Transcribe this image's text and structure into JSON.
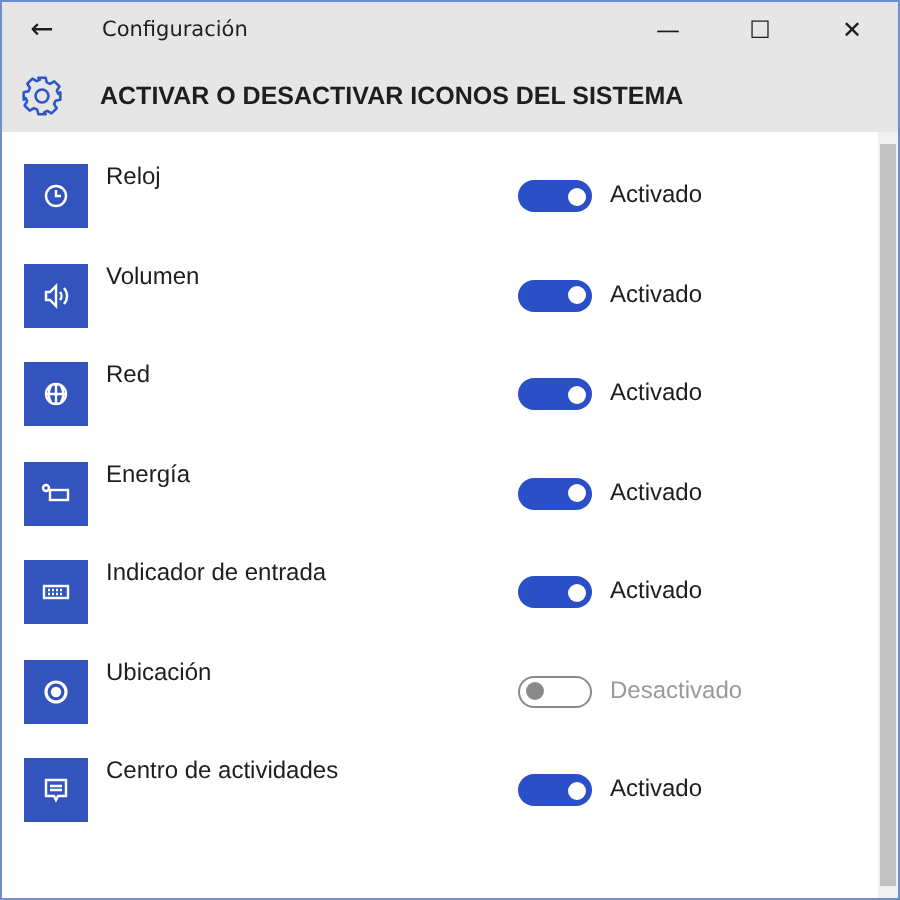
{
  "window": {
    "title": "Configuración",
    "back": "←",
    "minimize": "—",
    "maximize": "☐",
    "close": "✕"
  },
  "header": {
    "title": "ACTIVAR O DESACTIVAR ICONOS DEL SISTEMA"
  },
  "items": [
    {
      "name": "Reloj",
      "on": true,
      "state": "Activado"
    },
    {
      "name": "Volumen",
      "on": true,
      "state": "Activado"
    },
    {
      "name": "Red",
      "on": true,
      "state": "Activado"
    },
    {
      "name": "Energía",
      "on": true,
      "state": "Activado"
    },
    {
      "name": "Indicador de entrada",
      "on": true,
      "state": "Activado"
    },
    {
      "name": "Ubicación",
      "on": false,
      "state": "Desactivado"
    },
    {
      "name": "Centro de actividades",
      "on": true,
      "state": "Activado"
    }
  ]
}
